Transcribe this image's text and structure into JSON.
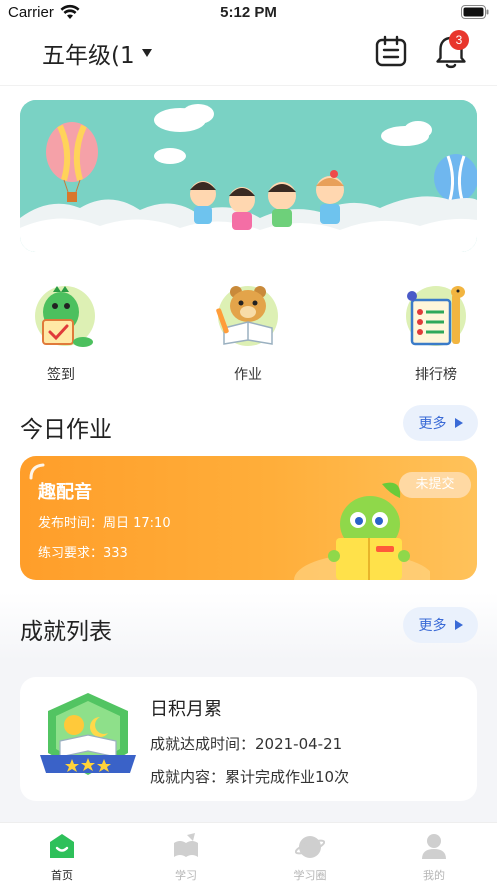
{
  "status_bar": {
    "carrier": "Carrier",
    "time": "5:12 PM"
  },
  "header": {
    "class_name": "五年级(1",
    "notification_count": "3"
  },
  "quick_entries": [
    {
      "label": "签到",
      "icon": "dinosaur-checkin-icon"
    },
    {
      "label": "作业",
      "icon": "bear-homework-icon"
    },
    {
      "label": "排行榜",
      "icon": "giraffe-ranking-icon"
    }
  ],
  "today_homework": {
    "title": "今日作业",
    "more": "更多",
    "card": {
      "name": "趣配音",
      "publish_time": "发布时间：周日 17:10",
      "requirement": "练习要求：333",
      "status": "未提交"
    }
  },
  "achievements": {
    "title": "成就列表",
    "more": "更多",
    "item": {
      "name": "日积月累",
      "achieved_time": "成就达成时间：2021-04-21",
      "content": "成就内容：累计完成作业10次"
    }
  },
  "tab_bar": [
    {
      "label": "首页",
      "icon": "home-icon",
      "active": true
    },
    {
      "label": "学习",
      "icon": "book-icon",
      "active": false
    },
    {
      "label": "学习圈",
      "icon": "planet-icon",
      "active": false
    },
    {
      "label": "我的",
      "icon": "profile-icon",
      "active": false
    }
  ],
  "colors": {
    "accent_blue": "#3a6ad6",
    "homework_orange": "#ff9e2a",
    "badge_red": "#e8362c",
    "tab_active_green": "#2ec05a"
  }
}
